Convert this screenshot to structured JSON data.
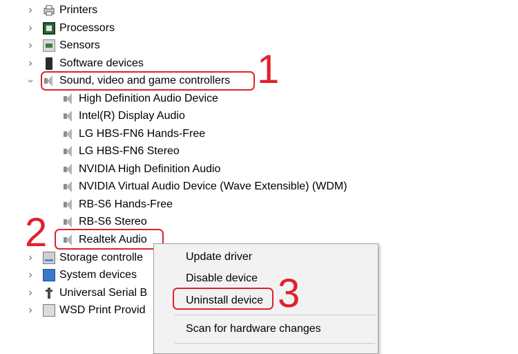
{
  "tree": {
    "items": [
      {
        "label": "Printers",
        "icon": "printer-icon"
      },
      {
        "label": "Processors",
        "icon": "processor-icon"
      },
      {
        "label": "Sensors",
        "icon": "sensor-icon"
      },
      {
        "label": "Software devices",
        "icon": "software-device-icon"
      },
      {
        "label": "Sound, video and game controllers",
        "icon": "speaker-icon",
        "expanded": true
      },
      {
        "label": "High Definition Audio Device",
        "icon": "speaker-icon"
      },
      {
        "label": "Intel(R) Display Audio",
        "icon": "speaker-icon"
      },
      {
        "label": "LG HBS-FN6 Hands-Free",
        "icon": "speaker-icon"
      },
      {
        "label": "LG HBS-FN6 Stereo",
        "icon": "speaker-icon"
      },
      {
        "label": "NVIDIA High Definition Audio",
        "icon": "speaker-icon"
      },
      {
        "label": "NVIDIA Virtual Audio Device (Wave Extensible) (WDM)",
        "icon": "speaker-icon"
      },
      {
        "label": "RB-S6 Hands-Free",
        "icon": "speaker-icon"
      },
      {
        "label": "RB-S6 Stereo",
        "icon": "speaker-icon"
      },
      {
        "label": "Realtek Audio",
        "icon": "speaker-icon",
        "selected": true
      },
      {
        "label": "Storage controlle",
        "icon": "storage-icon"
      },
      {
        "label": "System devices",
        "icon": "system-icon"
      },
      {
        "label": "Universal Serial B",
        "icon": "usb-icon"
      },
      {
        "label": "WSD Print Provid",
        "icon": "wsd-printer-icon"
      }
    ]
  },
  "context_menu": {
    "items": [
      "Update driver",
      "Disable device",
      "Uninstall device",
      "Scan for hardware changes"
    ]
  },
  "annotations": {
    "step1": "1",
    "step2": "2",
    "step3": "3",
    "color": "#e0212b"
  }
}
